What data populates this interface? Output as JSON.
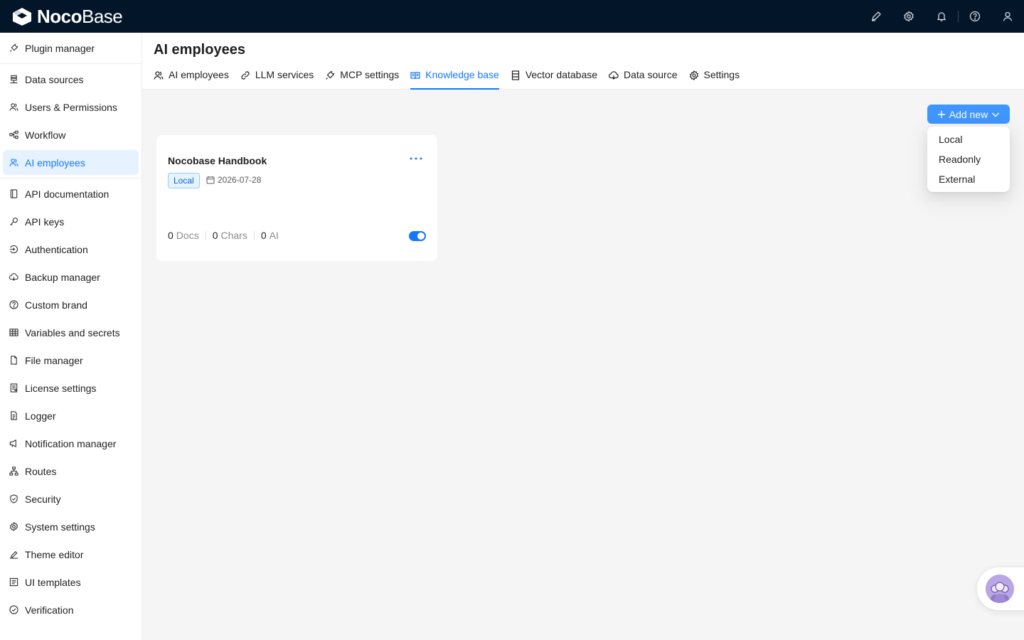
{
  "brand": {
    "name_bold": "Noco",
    "name_light": "Base"
  },
  "topbar": {
    "icons": [
      "brush-icon",
      "gear-icon",
      "bell-icon",
      "question-icon",
      "user-icon"
    ]
  },
  "sidebar": {
    "items": [
      {
        "label": "Plugin manager",
        "icon": "plug-icon"
      },
      {
        "label": "Data sources",
        "icon": "database-icon"
      },
      {
        "label": "Users & Permissions",
        "icon": "users-icon"
      },
      {
        "label": "Workflow",
        "icon": "workflow-icon"
      },
      {
        "label": "AI employees",
        "icon": "team-icon"
      },
      {
        "label": "API documentation",
        "icon": "book-icon"
      },
      {
        "label": "API keys",
        "icon": "key-icon"
      },
      {
        "label": "Authentication",
        "icon": "login-icon"
      },
      {
        "label": "Backup manager",
        "icon": "cloud-icon"
      },
      {
        "label": "Custom brand",
        "icon": "question-icon"
      },
      {
        "label": "Variables and secrets",
        "icon": "table-icon"
      },
      {
        "label": "File manager",
        "icon": "file-icon"
      },
      {
        "label": "License settings",
        "icon": "license-icon"
      },
      {
        "label": "Logger",
        "icon": "file-text-icon"
      },
      {
        "label": "Notification manager",
        "icon": "megaphone-icon"
      },
      {
        "label": "Routes",
        "icon": "routes-icon"
      },
      {
        "label": "Security",
        "icon": "shield-icon"
      },
      {
        "label": "System settings",
        "icon": "gear-icon"
      },
      {
        "label": "Theme editor",
        "icon": "brush-icon"
      },
      {
        "label": "UI templates",
        "icon": "template-icon"
      },
      {
        "label": "Verification",
        "icon": "check-circle-icon"
      }
    ],
    "active_index": 4
  },
  "header": {
    "title": "AI employees",
    "tabs": [
      {
        "label": "AI employees",
        "icon": "team-icon"
      },
      {
        "label": "LLM services",
        "icon": "link-icon"
      },
      {
        "label": "MCP settings",
        "icon": "plug-icon"
      },
      {
        "label": "Knowledge base",
        "icon": "book-open-icon"
      },
      {
        "label": "Vector database",
        "icon": "database-icon"
      },
      {
        "label": "Data source",
        "icon": "cloud-icon"
      },
      {
        "label": "Settings",
        "icon": "gear-icon"
      }
    ],
    "active_tab": 3
  },
  "main": {
    "add_button_label": "Add new",
    "dropdown_options": [
      "Local",
      "Readonly",
      "External"
    ],
    "card": {
      "title": "Nocobase Handbook",
      "tag": "Local",
      "date": "2026-07-28",
      "docs_count": "0",
      "docs_label": "Docs",
      "chars_count": "0",
      "chars_label": "Chars",
      "ai_count": "0",
      "ai_label": "AI",
      "enabled": true
    }
  },
  "colors": {
    "accent": "#1677ff",
    "topbar": "#031529",
    "active_bg": "#e6f2ff"
  }
}
